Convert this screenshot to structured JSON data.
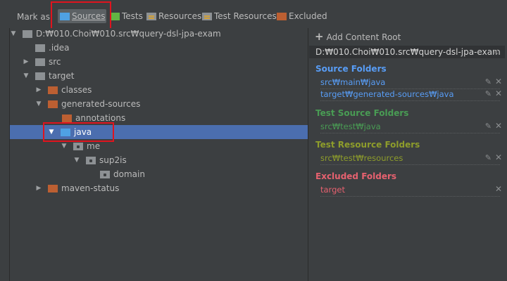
{
  "toolbar": {
    "mark_as": "Mark as:",
    "buttons": [
      {
        "label": "Sources",
        "icon": "sources-folder-icon"
      },
      {
        "label": "Tests",
        "icon": "tests-folder-icon"
      },
      {
        "label": "Resources",
        "icon": "resources-folder-icon"
      },
      {
        "label": "Test Resources",
        "icon": "test-resources-folder-icon"
      },
      {
        "label": "Excluded",
        "icon": "excluded-folder-icon"
      }
    ]
  },
  "tree": [
    {
      "label": "D:₩010.Choi₩010.src₩query-dsl-jpa-exam",
      "expanded": true,
      "folder": "grey"
    },
    {
      "label": ".idea",
      "folder": "grey"
    },
    {
      "label": "src",
      "expanded": false,
      "folder": "grey"
    },
    {
      "label": "target",
      "expanded": true,
      "folder": "grey"
    },
    {
      "label": "classes",
      "expanded": false,
      "folder": "orange"
    },
    {
      "label": "generated-sources",
      "expanded": true,
      "folder": "orange"
    },
    {
      "label": "annotations",
      "folder": "orange"
    },
    {
      "label": "java",
      "expanded": true,
      "folder": "blue",
      "selected": true
    },
    {
      "label": "me",
      "expanded": true,
      "folder": "package"
    },
    {
      "label": "sup2is",
      "expanded": true,
      "folder": "package"
    },
    {
      "label": "domain",
      "folder": "package"
    },
    {
      "label": "maven-status",
      "expanded": false,
      "folder": "orange"
    }
  ],
  "content_root": {
    "add_label": "Add Content Root",
    "path": "D:₩010.Choi₩010.src₩query-dsl-jpa-exam",
    "sections": [
      {
        "title": "Source Folders",
        "color": "#589df6",
        "entries": [
          "src₩main₩java",
          "target₩generated-sources₩java"
        ]
      },
      {
        "title": "Test Source Folders",
        "color": "#499c54",
        "entries": [
          "src₩test₩java"
        ]
      },
      {
        "title": "Test Resource Folders",
        "color": "#8e9d2b",
        "entries": [
          "src₩test₩resources"
        ]
      },
      {
        "title": "Excluded Folders",
        "color": "#e6616f",
        "entries": [
          "target"
        ]
      }
    ]
  }
}
